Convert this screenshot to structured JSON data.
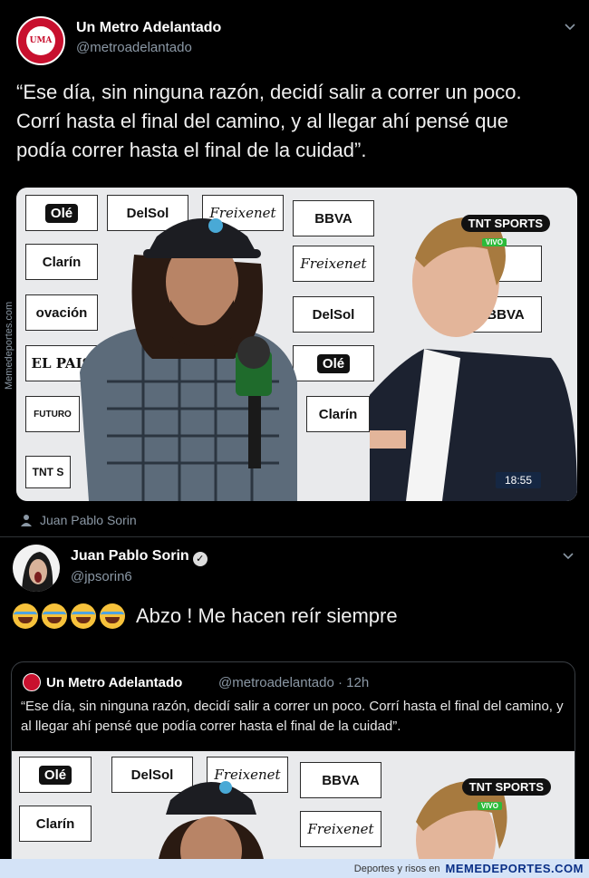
{
  "tweet1": {
    "name": "Un Metro Adelantado",
    "handle": "@metroadelantado",
    "text": "“Ese día, sin ninguna razón, decidí salir a correr un poco. Corrí hasta el final del camino, y al llegar ahí pensé que podía correr hasta el final de la cuidad”.",
    "avatar_text": "UMA",
    "retweeted_by": "Juan Pablo Sorin",
    "watermark": "Memedeportes.com"
  },
  "photo": {
    "sponsors": [
      "Olé",
      "DelSol",
      "Freixenet",
      "BBVA",
      "Clarín",
      "ovación",
      "EL PAIS",
      "FUTURO",
      "TNT S"
    ],
    "tnt_label": "SPORTS",
    "tnt_brand": "TNT",
    "vivo": "VIVO",
    "time": "18:55"
  },
  "tweet2": {
    "name": "Juan Pablo Sorin",
    "handle": "@jpsorin6",
    "text": "Abzo ! Me hacen reír siempre",
    "emoji_count": 4
  },
  "quote": {
    "name": "Un Metro Adelantado",
    "handle": "@metroadelantado · 12h",
    "text": "“Ese día, sin ninguna razón, decidí salir a correr un poco. Corrí hasta el final del camino, y al llegar ahí pensé que podía correr hasta el final de la cuidad”."
  },
  "footer": {
    "tagline": "Deportes y risos en",
    "site": "MEMEDEPORTES.COM"
  },
  "icons": {
    "chevron": "chevron-down-icon",
    "retweet": "person-icon",
    "verified": "verified-badge-icon"
  },
  "colors": {
    "background": "#000000",
    "accent_red": "#c8102e",
    "muted": "#8b98a5",
    "footer_bg": "#d4e3f7"
  }
}
